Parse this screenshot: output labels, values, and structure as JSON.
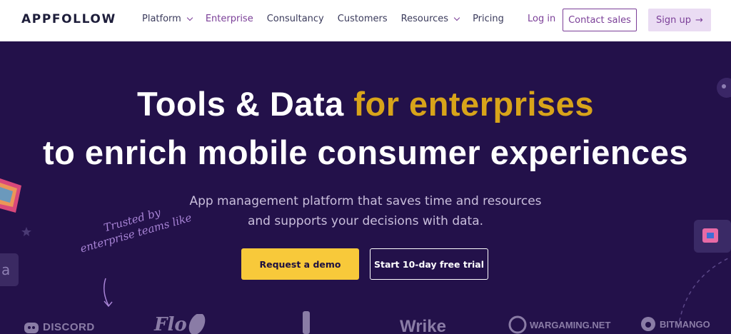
{
  "nav": {
    "logo": "APPFOLLOW",
    "links": [
      {
        "label": "Platform",
        "dropdown": true
      },
      {
        "label": "Enterprise",
        "dropdown": false,
        "active": true
      },
      {
        "label": "Consultancy",
        "dropdown": false
      },
      {
        "label": "Customers",
        "dropdown": false
      },
      {
        "label": "Resources",
        "dropdown": true
      },
      {
        "label": "Pricing",
        "dropdown": false
      }
    ],
    "login": "Log in",
    "contact": "Contact sales",
    "signup": "Sign up",
    "signup_arrow": "→"
  },
  "hero": {
    "title_part1": "Tools & Data ",
    "title_accent": "for enterprises",
    "title_line2": "to enrich mobile consumer experiences",
    "subtitle_line1": "App management platform that saves time and resources",
    "subtitle_line2": "and supports your decisions with data.",
    "demo_button": "Request a demo",
    "trial_button": "Start 10-day free trial",
    "trusted_line1": "Trusted by",
    "trusted_line2": "enterprise teams like"
  },
  "logos": {
    "discord": "DISCORD",
    "flo": "Flo",
    "wrike": "Wrike",
    "wargaming": "WARGAMING.NET",
    "bitmango": "BITMANGO"
  },
  "colors": {
    "background": "#23114a",
    "accent": "#d8a41a",
    "brand_purple": "#7b3f98",
    "demo_button": "#f8c93a"
  }
}
